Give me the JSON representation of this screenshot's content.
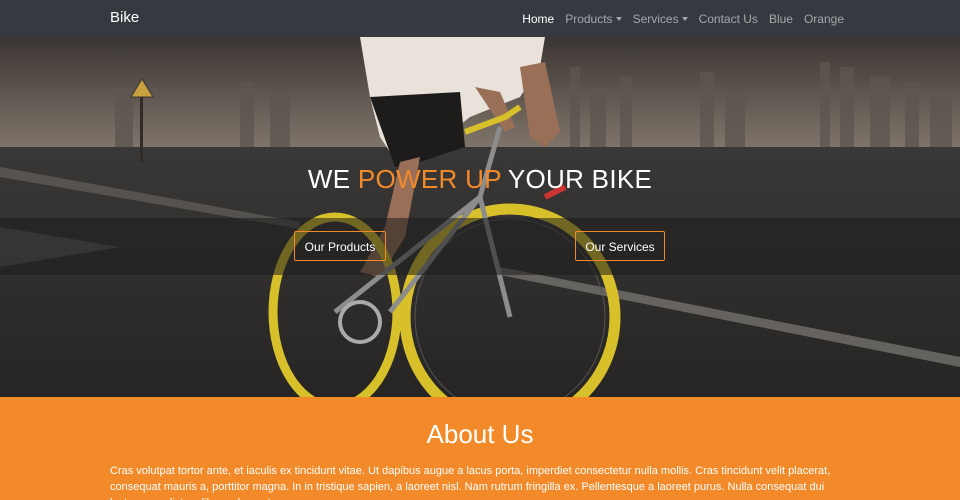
{
  "navbar": {
    "brand": "Bike",
    "items": [
      {
        "label": "Home",
        "active": true,
        "dropdown": false
      },
      {
        "label": "Products",
        "active": false,
        "dropdown": true
      },
      {
        "label": "Services",
        "active": false,
        "dropdown": true
      },
      {
        "label": "Contact Us",
        "active": false,
        "dropdown": false
      },
      {
        "label": "Blue",
        "active": false,
        "dropdown": false
      },
      {
        "label": "Orange",
        "active": false,
        "dropdown": false
      }
    ]
  },
  "hero": {
    "title_prefix": "WE",
    "title_accent": "POWER UP",
    "title_suffix": "YOUR BIKE",
    "primary_button": "Our Products",
    "secondary_button": "Our Services"
  },
  "about": {
    "heading": "About Us",
    "text": "Cras volutpat tortor ante, et iaculis ex tincidunt vitae. Ut dapibus augue a lacus porta, imperdiet consectetur nulla mollis. Cras tincidunt velit placerat, consequat mauris a, porttitor magna. In in tristique sapien, a laoreet nisl. Nam rutrum fringilla ex. Pellentesque a laoreet purus. Nulla consequat dui lectus, non dictum libero elementum."
  },
  "colors": {
    "navbar_bg": "#343a40",
    "accent": "#f28a2a",
    "about_bg": "#f28a2a"
  }
}
